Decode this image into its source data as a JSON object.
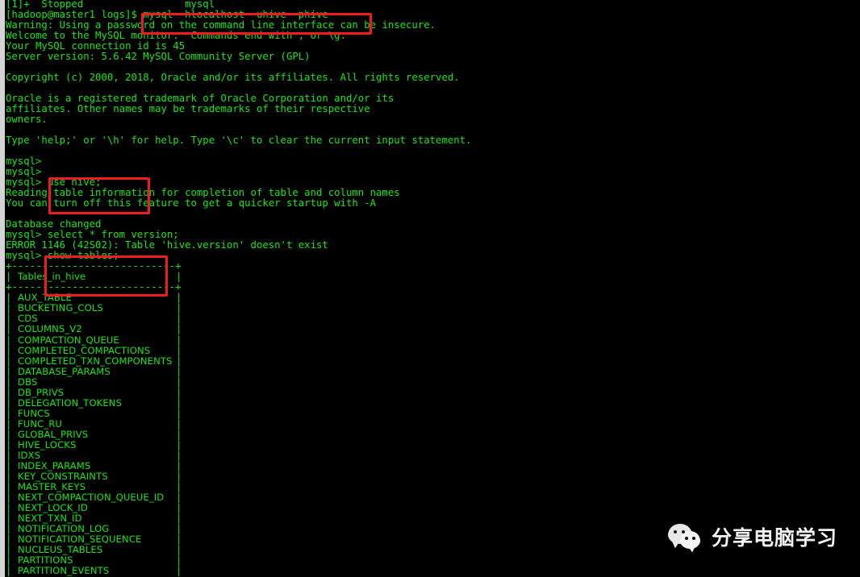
{
  "terminal": {
    "colors": {
      "background": "#000000",
      "text": "#17e617",
      "annotation": "#ee1c1c",
      "watermark_text": "#f2f2f2",
      "scrollbar": "#c9c9c9"
    },
    "lines": [
      "mysql>",
      "[1]+  Stopped                 mysql",
      "[hadoop@master1 logs]$ mysql -hlocalhost -uhive -phive",
      "Warning: Using a password on the command line interface can be insecure.",
      "Welcome to the MySQL monitor.  Commands end with ; or \\g.",
      "Your MySQL connection id is 45",
      "Server version: 5.6.42 MySQL Community Server (GPL)",
      "",
      "Copyright (c) 2000, 2018, Oracle and/or its affiliates. All rights reserved.",
      "",
      "Oracle is a registered trademark of Oracle Corporation and/or its",
      "affiliates. Other names may be trademarks of their respective",
      "owners.",
      "",
      "Type 'help;' or '\\h' for help. Type '\\c' to clear the current input statement.",
      "",
      "mysql>",
      "mysql>",
      "mysql> use hive;",
      "Reading table information for completion of table and column names",
      "You can turn off this feature to get a quicker startup with -A",
      "",
      "Database changed",
      "mysql> select * from version;",
      "ERROR 1146 (42S02): Table 'hive.version' doesn't exist",
      "mysql> show tables;"
    ],
    "result_table": {
      "border": "+---------------------------+",
      "header": "Tables_in_hive",
      "rows": [
        "AUX_TABLE",
        "BUCKETING_COLS",
        "CDS",
        "COLUMNS_V2",
        "COMPACTION_QUEUE",
        "COMPLETED_COMPACTIONS",
        "COMPLETED_TXN_COMPONENTS",
        "DATABASE_PARAMS",
        "DBS",
        "DB_PRIVS",
        "DELEGATION_TOKENS",
        "FUNCS",
        "FUNC_RU",
        "GLOBAL_PRIVS",
        "HIVE_LOCKS",
        "IDXS",
        "INDEX_PARAMS",
        "KEY_CONSTRAINTS",
        "MASTER_KEYS",
        "NEXT_COMPACTION_QUEUE_ID",
        "NEXT_LOCK_ID",
        "NEXT_TXN_ID",
        "NOTIFICATION_LOG",
        "NOTIFICATION_SEQUENCE",
        "NUCLEUS_TABLES",
        "PARTITIONS",
        "PARTITION_EVENTS"
      ]
    }
  },
  "annotations": [
    {
      "id": "anno-1",
      "label": "mysql-connect-command-highlight"
    },
    {
      "id": "anno-2",
      "label": "use-hive-command-highlight"
    },
    {
      "id": "anno-3",
      "label": "show-tables-command-highlight"
    }
  ],
  "watermark": {
    "icon": "wechat-icon",
    "text": "分享电脑学习"
  }
}
